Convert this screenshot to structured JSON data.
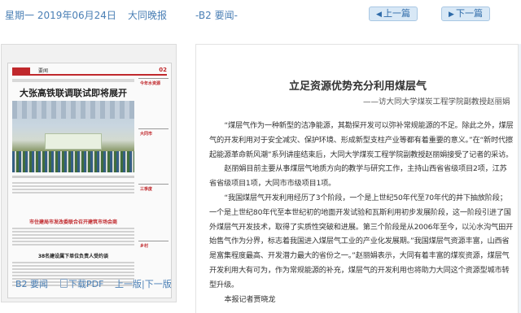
{
  "header": {
    "date": "星期一  2019年06月24日",
    "paper": "大同晚报",
    "edition": "-B2 要闻-",
    "prev_label": "上一篇",
    "next_label": "下一篇"
  },
  "thumbnail": {
    "page_no": "02",
    "section": "要闻",
    "headline": "大张高铁联调联试即将展开",
    "side_heads": [
      "今年水资源",
      "大同市",
      "三季度",
      "乡村"
    ],
    "sub_headline_1": "市住建局市发改委联合召开建筑市场会商",
    "sub_headline_2": "38名建设属下单位负责人受约谈"
  },
  "footer": {
    "edition_link": "B2 要闻",
    "pdf_link": "下载PDF",
    "prev_edition": "上一版",
    "next_edition": "下一版"
  },
  "article": {
    "title": "立足资源优势充分利用煤层气",
    "subtitle": "——访大同大学煤炭工程学院副教授赵丽娟",
    "paragraphs": [
      "“煤层气作为一种新型的洁净能源，其勘探开发可以弥补常规能源的不足。除此之外，煤层气的开发利用对于安全减灾、保护环境、形成新型支柱产业等都有着重要的意义。”在“新时代擦起能源革命新风潮”系列讲座结束后，大同大学煤炭工程学院副教授赵丽娟接受了记者的采访。",
      "赵丽娟目前主要从事煤层气地质方向的教学与研究工作，主持山西省省级项目2项，江苏省省级项目1项，大同市市级项目1项。",
      "“我国煤层气开发利用经历了3个阶段，一个是上世纪50年代至70年代的井下抽放阶段；一个是上世纪80年代至本世纪初的地面开发试验和瓦斯利用初步发展阶段，这一阶段引进了国外煤层气开发技术，取得了实质性突破和进展。第三个阶段是从2006年至今，以沁水沟气田开始售气作为分界，标志着我国进入煤层气工业的产业化发展期。”我国煤层气资源丰富，山西省是富集程度最高、开发潜力最大的省份之一。”赵丽娟表示，大同有着丰富的煤炭资源，煤层气开发利用大有可为，作为常规能源的补充，煤层气的开发利用也将助力大同这个资源型城市转型升级。",
      "本报记者贾晓龙"
    ]
  }
}
